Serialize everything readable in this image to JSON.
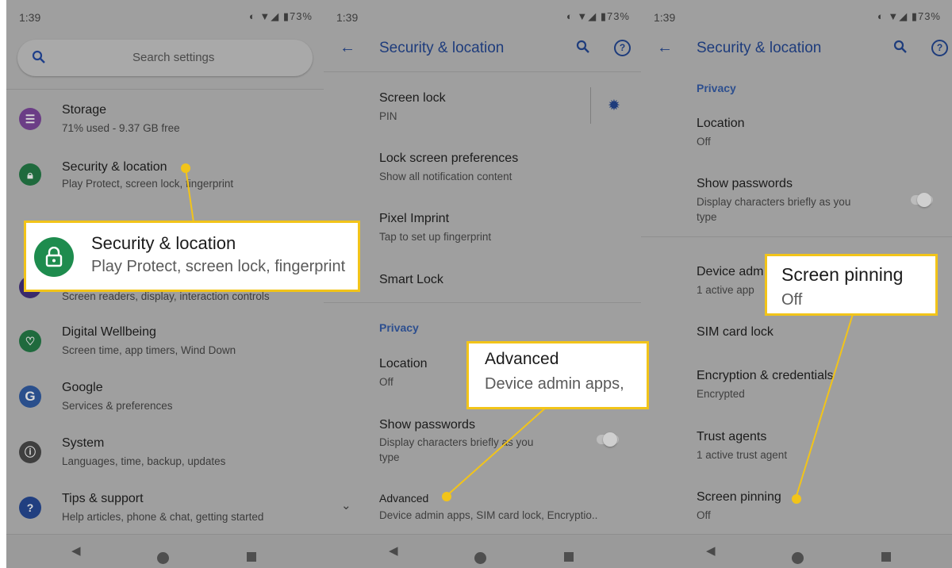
{
  "status": {
    "time": "1:39",
    "battery": "73%"
  },
  "panel1": {
    "search_placeholder": "Search settings",
    "items": [
      {
        "title": "Storage",
        "sub": "71% used - 9.37 GB free",
        "color": "#6b3d86",
        "icon": "storage-icon"
      },
      {
        "title": "Security & location",
        "sub": "Play Protect, screen lock, fingerprint",
        "color": "#1f6a3d",
        "icon": "lock-icon"
      },
      {
        "title": "",
        "sub": "Screen readers, display, interaction controls",
        "color": "#3a2a6c",
        "icon": "accessibility-icon"
      },
      {
        "title": "Digital Wellbeing",
        "sub": "Screen time, app timers, Wind Down",
        "color": "#1f6a3d",
        "icon": "wellbeing-icon"
      },
      {
        "title": "Google",
        "sub": "Services & preferences",
        "color": "#2a4f8c",
        "icon": "google-icon"
      },
      {
        "title": "System",
        "sub": "Languages, time, backup, updates",
        "color": "#3f3f3f",
        "icon": "info-icon"
      },
      {
        "title": "Tips & support",
        "sub": "Help articles, phone & chat, getting started",
        "color": "#213f80",
        "icon": "help-icon"
      }
    ],
    "callout": {
      "title": "Security & location",
      "sub": "Play Protect, screen lock, fingerprint",
      "color": "#1e8c4e"
    }
  },
  "panel2": {
    "title": "Security & location",
    "rows": [
      {
        "title": "Screen lock",
        "sub": "PIN"
      },
      {
        "title": "Lock screen preferences",
        "sub": "Show all notification content"
      },
      {
        "title": "Pixel Imprint",
        "sub": "Tap to set up fingerprint"
      },
      {
        "title": "Smart Lock",
        "sub": ""
      }
    ],
    "privacy_label": "Privacy",
    "location": {
      "title": "Location",
      "sub": "Off"
    },
    "show_passwords": {
      "title": "Show passwords",
      "sub1": "Display characters briefly as you",
      "sub2": "type"
    },
    "advanced": {
      "title": "Advanced",
      "sub": "Device admin apps, SIM card lock, Encryptio.."
    },
    "callout": {
      "title": "Advanced",
      "sub": "Device admin apps,"
    }
  },
  "panel3": {
    "title": "Security & location",
    "privacy_label": "Privacy",
    "location": {
      "title": "Location",
      "sub": "Off"
    },
    "show_passwords": {
      "title": "Show passwords",
      "sub1": "Display characters briefly as you",
      "sub2": "type"
    },
    "device_admin": {
      "title": "Device adm",
      "sub": "1 active app"
    },
    "sim_lock": {
      "title": "SIM card lock"
    },
    "encryption": {
      "title": "Encryption & credentials",
      "sub": "Encrypted"
    },
    "trust_agents": {
      "title": "Trust agents",
      "sub": "1 active trust agent"
    },
    "screen_pinning": {
      "title": "Screen pinning",
      "sub": "Off"
    },
    "callout": {
      "title": "Screen pinning",
      "sub": "Off"
    }
  },
  "colors": {
    "highlight": "#f2c419",
    "accent": "#1e3c7c"
  }
}
